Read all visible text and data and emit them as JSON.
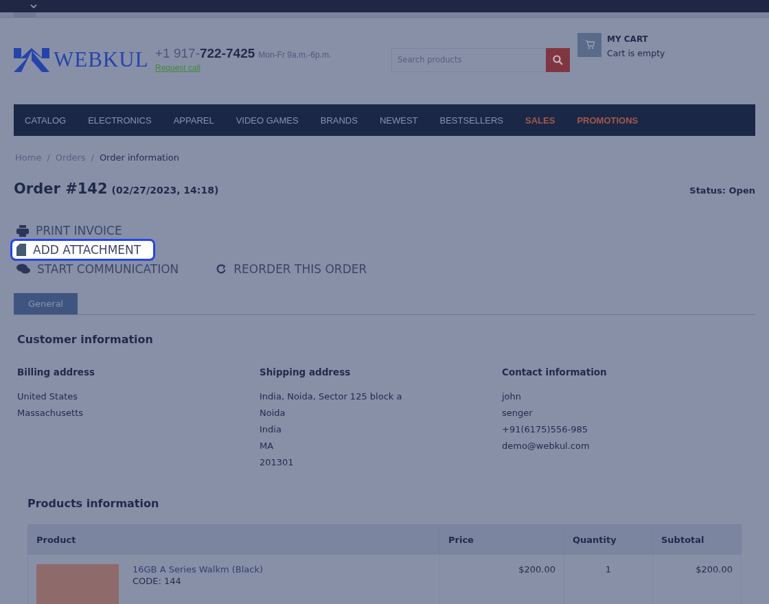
{
  "header": {
    "logo_text": "WEBKUL",
    "phone_prefix": "+1 917-",
    "phone_main": "722-7425",
    "hours": "Mon-Fr 9a.m.-6p.m.",
    "request_call": "Request call",
    "search": {
      "placeholder": "Search products"
    },
    "cart": {
      "title": "MY CART",
      "status": "Cart is empty"
    }
  },
  "nav": [
    {
      "label": "CATALOG",
      "kind": "normal"
    },
    {
      "label": "ELECTRONICS",
      "kind": "normal"
    },
    {
      "label": "APPAREL",
      "kind": "normal"
    },
    {
      "label": "VIDEO GAMES",
      "kind": "normal"
    },
    {
      "label": "BRANDS",
      "kind": "normal"
    },
    {
      "label": "NEWEST",
      "kind": "normal"
    },
    {
      "label": "BESTSELLERS",
      "kind": "normal"
    },
    {
      "label": "SALES",
      "kind": "accent"
    },
    {
      "label": "PROMOTIONS",
      "kind": "accent"
    }
  ],
  "breadcrumbs": [
    "Home",
    "Orders",
    "Order information"
  ],
  "breadcrumb_separator": "/",
  "order": {
    "title": "Order #142",
    "date": "(02/27/2023, 14:18)",
    "status": "Status: Open"
  },
  "actions": [
    {
      "label": "PRINT INVOICE",
      "kind": "print",
      "highlighted": false
    },
    {
      "label": "ADD ATTACHMENT",
      "kind": "file",
      "highlighted": true
    },
    {
      "label": "START COMMUNICATION",
      "kind": "chat",
      "highlighted": false
    },
    {
      "label": "REORDER THIS ORDER",
      "kind": "reorder",
      "highlighted": false
    }
  ],
  "tabs": [
    {
      "label": "General",
      "selected": true
    }
  ],
  "customer": {
    "title": "Customer information",
    "columns": [
      {
        "heading": "Billing address",
        "lines": [
          "United States",
          "Massachusetts"
        ]
      },
      {
        "heading": "Shipping address",
        "lines": [
          "India, Noida, Sector 125 block a",
          "Noida",
          "India",
          "MA",
          "201301"
        ]
      },
      {
        "heading": "Contact information",
        "lines": [
          "john",
          "senger",
          "+91(6175)556-985",
          "demo@webkul.com"
        ]
      }
    ]
  },
  "products": {
    "title": "Products information",
    "columns": [
      "Product",
      "Price",
      "Quantity",
      "Subtotal"
    ],
    "rows": [
      {
        "name": "16GB A Series Walkm (Black)",
        "code": "CODE: 144",
        "price": "$200.00",
        "quantity": "1",
        "subtotal": "$200.00"
      }
    ]
  }
}
